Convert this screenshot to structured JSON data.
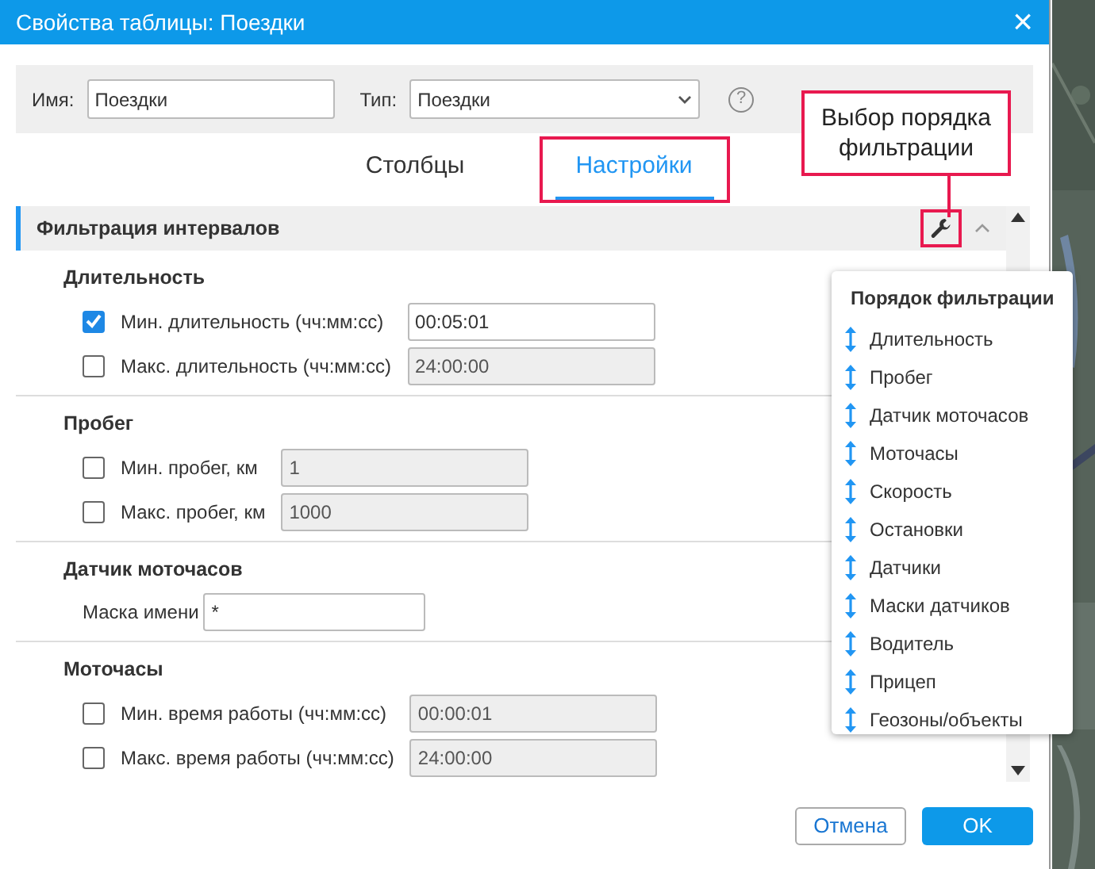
{
  "window": {
    "title": "Свойства таблицы: Поездки",
    "close": "×"
  },
  "name_field": {
    "label": "Имя:",
    "value": "Поездки"
  },
  "type_field": {
    "label": "Тип:",
    "value": "Поездки"
  },
  "help": "?",
  "tabs": [
    {
      "label": "Столбцы",
      "selected": false,
      "highlighted": false
    },
    {
      "label": "Настройки",
      "selected": true,
      "highlighted": true
    }
  ],
  "section": {
    "title": "Фильтрация интервалов",
    "expanded": true,
    "tool_highlighted": true
  },
  "groups": [
    {
      "title": "Длительность",
      "rows": [
        {
          "kind": "checkbox",
          "label": "Мин. длительность (чч:мм:сс)",
          "checked": true,
          "value": "00:05:01"
        },
        {
          "kind": "checkbox",
          "label": "Макс. длительность (чч:мм:сс)",
          "checked": false,
          "value": "24:00:00"
        }
      ]
    },
    {
      "title": "Пробег",
      "rows": [
        {
          "kind": "checkbox",
          "label": "Мин. пробег, км",
          "checked": false,
          "value": "1"
        },
        {
          "kind": "checkbox",
          "label": "Макс. пробег, км",
          "checked": false,
          "value": "1000"
        }
      ]
    },
    {
      "title": "Датчик моточасов",
      "rows": [
        {
          "kind": "text",
          "label": "Маска имени",
          "value": "*"
        }
      ]
    },
    {
      "title": "Моточасы",
      "rows": [
        {
          "kind": "checkbox",
          "label": "Мин. время работы (чч:мм:сс)",
          "checked": false,
          "value": "00:00:01"
        },
        {
          "kind": "checkbox",
          "label": "Макс. время работы (чч:мм:сс)",
          "checked": false,
          "value": "24:00:00"
        }
      ]
    }
  ],
  "callout": {
    "text": "Выбор порядка фильтрации"
  },
  "popover": {
    "title": "Порядок фильтрации",
    "items": [
      "Длительность",
      "Пробег",
      "Датчик моточасов",
      "Моточасы",
      "Скорость",
      "Остановки",
      "Датчики",
      "Маски датчиков",
      "Водитель",
      "Прицеп",
      "Геозоны/объекты"
    ]
  },
  "buttons": [
    {
      "label": "Отмена",
      "kind": "secondary"
    },
    {
      "label": "OK",
      "kind": "primary"
    }
  ]
}
